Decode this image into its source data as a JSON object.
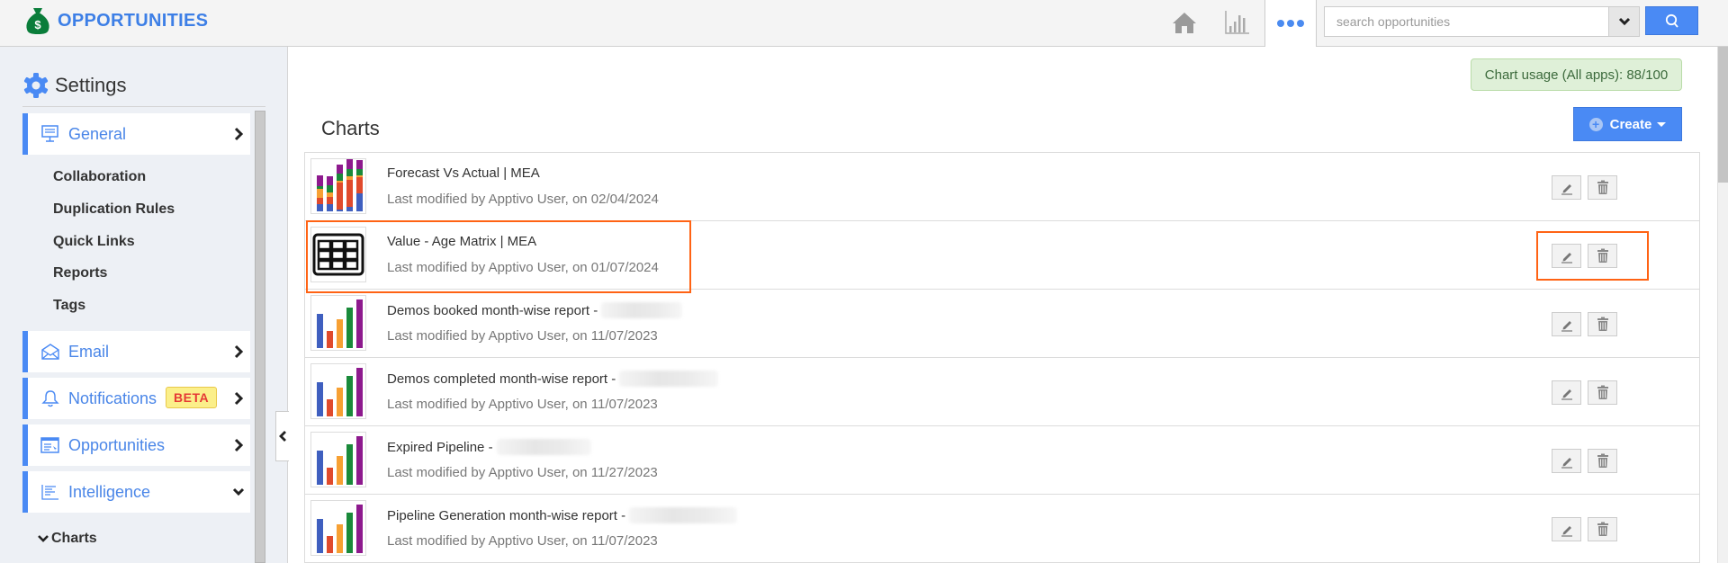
{
  "header": {
    "app_title": "OPPORTUNITIES",
    "brand_icon": "money-bag-icon",
    "nav": [
      {
        "name": "home",
        "icon": "home-icon"
      },
      {
        "name": "reports",
        "icon": "bar-chart-icon"
      },
      {
        "name": "more",
        "icon": "more-dots-icon",
        "active": true
      }
    ],
    "search": {
      "placeholder": "search opportunities",
      "value": ""
    }
  },
  "sidebar": {
    "title": "Settings",
    "title_icon": "gear-icon",
    "items": [
      {
        "label": "General",
        "icon": "monitor-icon",
        "expanded": true,
        "chevron": "right"
      },
      {
        "label": "Email",
        "icon": "envelope-icon",
        "chevron": "right"
      },
      {
        "label": "Notifications",
        "icon": "bell-icon",
        "badge": "BETA",
        "chevron": "right"
      },
      {
        "label": "Opportunities",
        "icon": "app-window-icon",
        "chevron": "right"
      },
      {
        "label": "Intelligence",
        "icon": "lines-icon",
        "chevron": "down"
      }
    ],
    "general_subitems": [
      "Collaboration",
      "Duplication Rules",
      "Quick Links",
      "Reports",
      "Tags"
    ],
    "intelligence_subitems": [
      {
        "label": "Charts",
        "expanded": true
      }
    ]
  },
  "main": {
    "usage_badge": "Chart usage (All apps): 88/100",
    "title": "Charts",
    "create_label": "Create",
    "charts": [
      {
        "title": "Forecast Vs Actual | MEA",
        "redacted": false,
        "modified": "Last modified by Apptivo User, on 02/04/2024",
        "thumb": "stacked-bar",
        "highlighted": false
      },
      {
        "title": "Value - Age Matrix | MEA",
        "redacted": false,
        "modified": "Last modified by Apptivo User, on 01/07/2024",
        "thumb": "table-grid",
        "highlighted": true
      },
      {
        "title": "Demos booked month-wise report -",
        "redacted": true,
        "modified": "Last modified by Apptivo User, on 11/07/2023",
        "thumb": "bar",
        "highlighted": false
      },
      {
        "title": "Demos completed month-wise report -",
        "redacted": true,
        "modified": "Last modified by Apptivo User, on 11/07/2023",
        "thumb": "bar",
        "highlighted": false
      },
      {
        "title": "Expired Pipeline -",
        "redacted": true,
        "modified": "Last modified by Apptivo User, on 11/27/2023",
        "thumb": "bar",
        "highlighted": false
      },
      {
        "title": "Pipeline Generation month-wise report -",
        "redacted": true,
        "modified": "Last modified by Apptivo User, on 11/07/2023",
        "thumb": "bar",
        "highlighted": false
      }
    ],
    "row_actions": [
      {
        "name": "edit",
        "icon": "pencil-icon"
      },
      {
        "name": "delete",
        "icon": "trash-icon"
      }
    ]
  },
  "colors": {
    "accent": "#4a8af4",
    "brand_text": "#3d7fe6",
    "highlight": "#ff6314",
    "beta_text": "#e53935",
    "beta_bg": "#fbef8a",
    "usage_bg": "#dff0d8",
    "thumb_series": [
      "#3f5fbf",
      "#e04a2c",
      "#f7a033",
      "#1a8a3a",
      "#8e1a8e"
    ]
  }
}
